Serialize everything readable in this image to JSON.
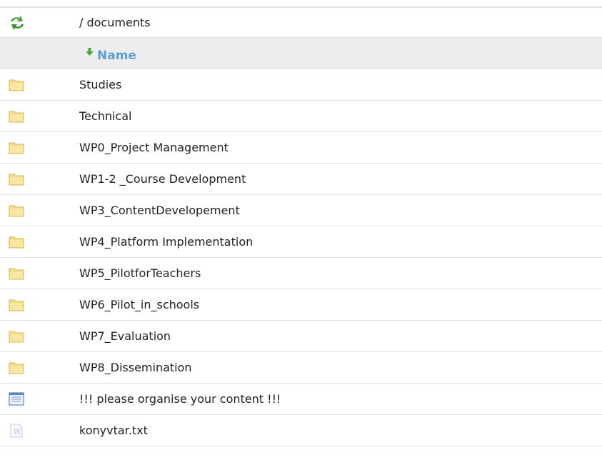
{
  "path": "/ documents",
  "header": {
    "name_label": "Name",
    "sort": "ascending"
  },
  "icons": {
    "refresh": "refresh-icon",
    "folder": "folder-icon",
    "page": "page-icon",
    "text_file": "text-file-icon"
  },
  "colors": {
    "header_text": "#5f9fd2",
    "header_bg": "#ededed",
    "folder": "#f4dc86",
    "sort_arrow": "#4ca43a"
  },
  "items": [
    {
      "name": "Studies",
      "type": "folder"
    },
    {
      "name": "Technical",
      "type": "folder"
    },
    {
      "name": "WP0_Project Management",
      "type": "folder"
    },
    {
      "name": "WP1-2 _Course Development",
      "type": "folder"
    },
    {
      "name": "WP3_ContentDevelopement",
      "type": "folder"
    },
    {
      "name": "WP4_Platform Implementation",
      "type": "folder"
    },
    {
      "name": "WP5_PilotforTeachers",
      "type": "folder"
    },
    {
      "name": "WP6_Pilot_in_schools",
      "type": "folder"
    },
    {
      "name": "WP7_Evaluation",
      "type": "folder"
    },
    {
      "name": "WP8_Dissemination",
      "type": "folder"
    },
    {
      "name": "!!!  please organise your content !!!",
      "type": "page"
    },
    {
      "name": "konyvtar.txt",
      "type": "text_file"
    }
  ]
}
